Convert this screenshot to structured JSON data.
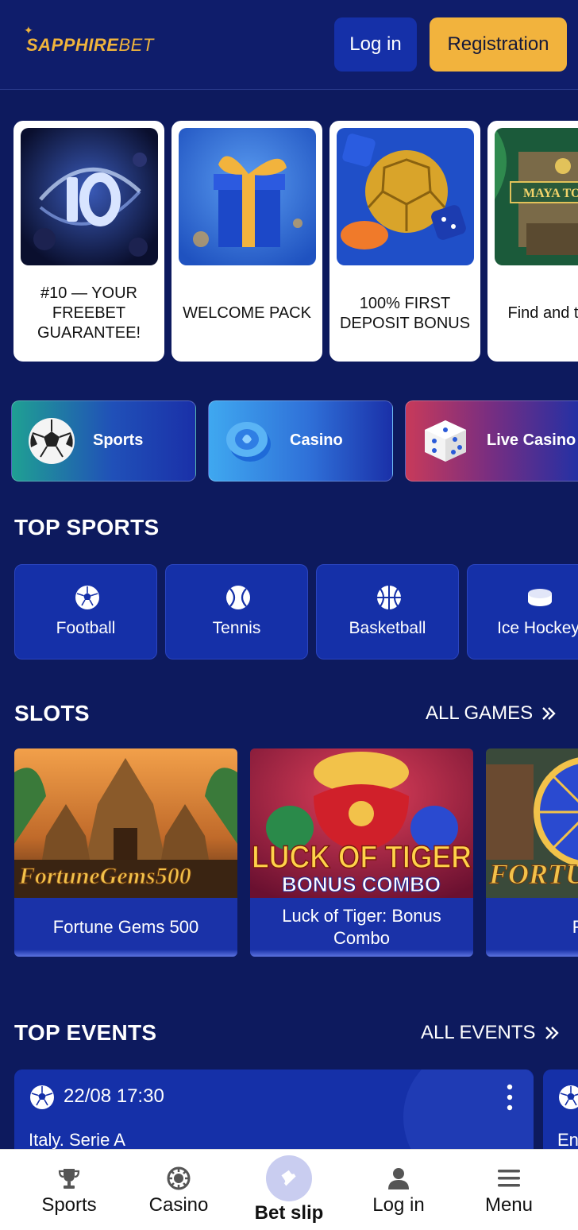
{
  "header": {
    "logo": {
      "main": "SAPPHIRE",
      "thin": "BET"
    },
    "login_label": "Log in",
    "register_label": "Registration"
  },
  "promos": [
    {
      "text": "#10 — YOUR FREEBET GUARANTEE!",
      "image": "ten-logo-artwork"
    },
    {
      "text": "WELCOME PACK",
      "image": "gift-box-artwork"
    },
    {
      "text": "100% FIRST DEPOSIT BONUS",
      "image": "golden-ball-artwork"
    },
    {
      "text": "Find and treasu",
      "image": "maya-temple-artwork",
      "image_text": "MAYA TO"
    }
  ],
  "categories": [
    {
      "label": "Sports",
      "icon": "soccer-ball-icon"
    },
    {
      "label": "Casino",
      "icon": "casino-chip-icon"
    },
    {
      "label": "Live Casino",
      "icon": "dice-icon"
    }
  ],
  "top_sports": {
    "title": "TOP SPORTS",
    "items": [
      {
        "label": "Football",
        "icon": "football-icon"
      },
      {
        "label": "Tennis",
        "icon": "tennis-ball-icon"
      },
      {
        "label": "Basketball",
        "icon": "basketball-icon"
      },
      {
        "label": "Ice Hockey",
        "icon": "hockey-puck-icon"
      }
    ]
  },
  "slots": {
    "title": "SLOTS",
    "link": "ALL GAMES",
    "items": [
      {
        "name": "Fortune Gems 500",
        "art_text": "FortuneGems500"
      },
      {
        "name": "Luck of Tiger: Bonus Combo",
        "art_text": "LUCK OF TIGER",
        "art_sub": "BONUS COMBO"
      },
      {
        "name": "Fortun",
        "art_text": "FORTUN"
      }
    ]
  },
  "top_events": {
    "title": "TOP EVENTS",
    "link": "ALL EVENTS",
    "items": [
      {
        "time": "22/08 17:30",
        "league": "Italy. Serie A"
      },
      {
        "time": "",
        "league": "En"
      }
    ]
  },
  "bottom_nav": [
    {
      "label": "Sports",
      "icon": "trophy-icon"
    },
    {
      "label": "Casino",
      "icon": "casino-chip-icon"
    },
    {
      "label": "Bet slip",
      "icon": "ticket-icon"
    },
    {
      "label": "Log in",
      "icon": "user-icon"
    },
    {
      "label": "Menu",
      "icon": "hamburger-menu-icon"
    }
  ],
  "colors": {
    "background": "#0d1a5e",
    "header": "#0f1d6b",
    "primary": "#1530a8",
    "accent": "#f2b33d"
  }
}
